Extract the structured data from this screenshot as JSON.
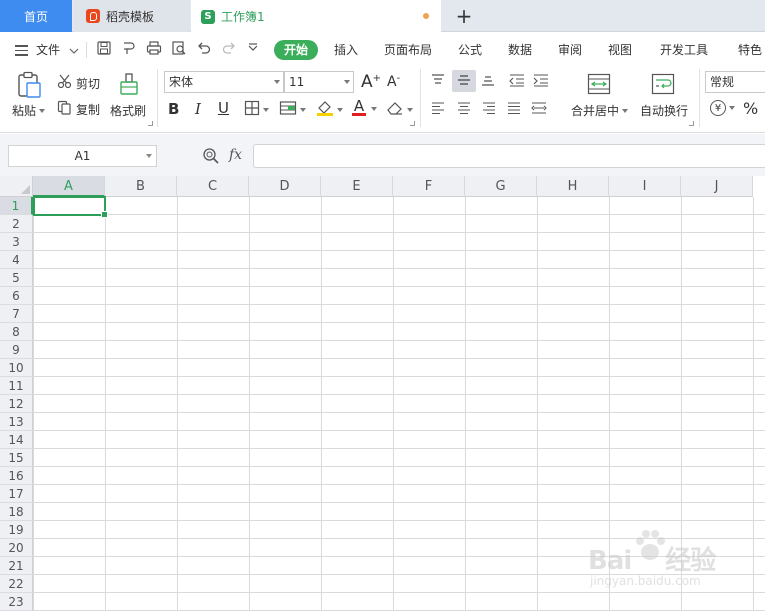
{
  "tabs": {
    "home": "首页",
    "docer": "稻壳模板",
    "workbook": "工作簿1",
    "new_tab": "+"
  },
  "menu": {
    "file": "文件",
    "items": [
      "开始",
      "插入",
      "页面布局",
      "公式",
      "数据",
      "审阅",
      "视图",
      "开发工具",
      "特色"
    ]
  },
  "ribbon": {
    "paste": "粘贴",
    "cut": "剪切",
    "copy": "复制",
    "format_painter": "格式刷",
    "font_name": "宋体",
    "font_size": "11",
    "bold": "B",
    "italic": "I",
    "underline": "U",
    "font_color_letter": "A",
    "grow_font": "A",
    "shrink_font": "A",
    "merge_center": "合并居中",
    "auto_wrap": "自动换行",
    "number_format": "常规",
    "currency": "¥",
    "percent": "%"
  },
  "formula_bar": {
    "name_box": "A1",
    "fx_label": "fx",
    "formula": ""
  },
  "grid": {
    "columns": [
      "A",
      "B",
      "C",
      "D",
      "E",
      "F",
      "G",
      "H",
      "I",
      "J"
    ],
    "rows": [
      "1",
      "2",
      "3",
      "4",
      "5",
      "6",
      "7",
      "8",
      "9",
      "10",
      "11",
      "12",
      "13",
      "14",
      "15",
      "16",
      "17",
      "18",
      "19",
      "20",
      "21",
      "22",
      "23"
    ],
    "selected_cell": "A1"
  },
  "watermark": {
    "brand": "Bai",
    "brand2": "经验",
    "url": "jingyan.baidu.com"
  },
  "colors": {
    "accent_green": "#2e9e5b",
    "home_tab_blue": "#3f8cf0",
    "active_menu_green": "#3aae5a"
  }
}
